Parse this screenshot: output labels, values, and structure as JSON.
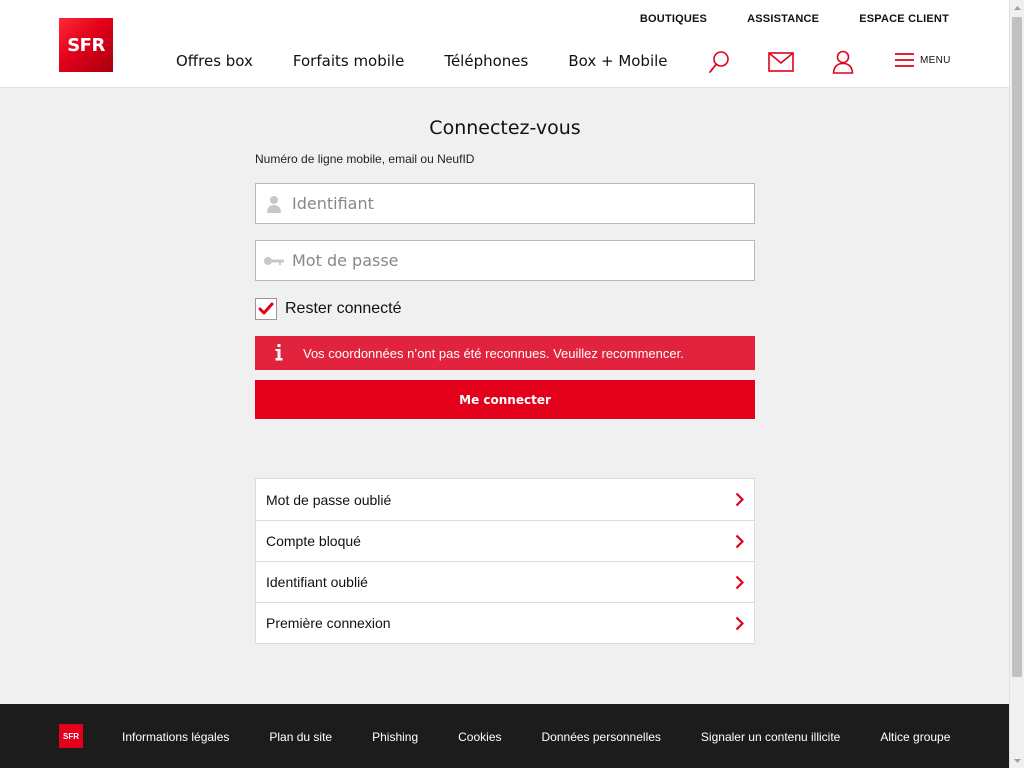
{
  "header": {
    "logo": "SFR",
    "top_links": [
      "BOUTIQUES",
      "ASSISTANCE",
      "ESPACE CLIENT"
    ],
    "nav": [
      "Offres box",
      "Forfaits mobile",
      "Téléphones",
      "Box + Mobile"
    ],
    "menu_label": "MENU"
  },
  "login": {
    "title": "Connectez-vous",
    "field_label": "Numéro de ligne mobile, email ou NeufID",
    "username_placeholder": "Identifiant",
    "password_placeholder": "Mot de passe",
    "remember_label": "Rester connecté",
    "remember_checked": true,
    "error_message": "Vos coordonnées n’ont pas été reconnues. Veuillez recommencer.",
    "submit_label": "Me connecter"
  },
  "help_links": [
    "Mot de passe oublié",
    "Compte bloqué",
    "Identifiant oublié",
    "Première connexion"
  ],
  "footer": {
    "logo": "SFR",
    "links": [
      "Informations légales",
      "Plan du site",
      "Phishing",
      "Cookies",
      "Données personnelles",
      "Signaler un contenu illicite",
      "Altice groupe"
    ]
  },
  "colors": {
    "brand_red": "#e2001a",
    "error_red": "#e2233d",
    "footer_bg": "#1c1c1c",
    "page_bg": "#f0f0f1"
  },
  "icons": [
    "search-icon",
    "mail-icon",
    "user-icon",
    "menu-icon",
    "person-icon",
    "key-icon",
    "info-icon",
    "chevron-right-icon",
    "checkmark-icon"
  ]
}
